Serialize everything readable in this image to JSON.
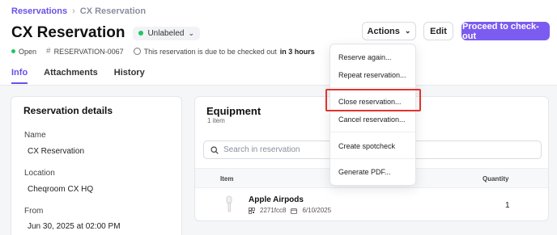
{
  "breadcrumb": {
    "parent": "Reservations",
    "current": "CX Reservation"
  },
  "header": {
    "title": "CX Reservation",
    "label": "Unlabeled",
    "status": "Open",
    "reference": "RESERVATION-0067",
    "due_text": "This reservation is due to be checked out",
    "due_emphasis": "in 3 hours"
  },
  "toolbar": {
    "actions_label": "Actions",
    "edit_label": "Edit",
    "checkout_label": "Proceed to check-out"
  },
  "tabs": [
    {
      "label": "Info"
    },
    {
      "label": "Attachments"
    },
    {
      "label": "History"
    }
  ],
  "details": {
    "title": "Reservation details",
    "fields": [
      {
        "label": "Name",
        "value": "CX Reservation"
      },
      {
        "label": "Location",
        "value": "Cheqroom CX HQ"
      },
      {
        "label": "From",
        "value": "Jun 30, 2025 at 02:00 PM"
      }
    ]
  },
  "equipment": {
    "title": "Equipment",
    "count": "1 item",
    "search_placeholder": "Search in reservation",
    "columns": {
      "item": "Item",
      "quantity": "Quantity"
    },
    "rows": [
      {
        "name": "Apple Airpods",
        "code": "2271fcc8",
        "date": "6/10/2025",
        "quantity": "1"
      }
    ]
  },
  "actions_menu": {
    "items": [
      {
        "label": "Reserve again..."
      },
      {
        "label": "Repeat reservation..."
      },
      {
        "label": "Close reservation..."
      },
      {
        "label": "Cancel reservation..."
      },
      {
        "label": "Create spotcheck"
      },
      {
        "label": "Generate PDF..."
      }
    ]
  },
  "colors": {
    "accent": "#7c5cf0",
    "status_green": "#22c55e",
    "highlight": "#e0332f"
  }
}
